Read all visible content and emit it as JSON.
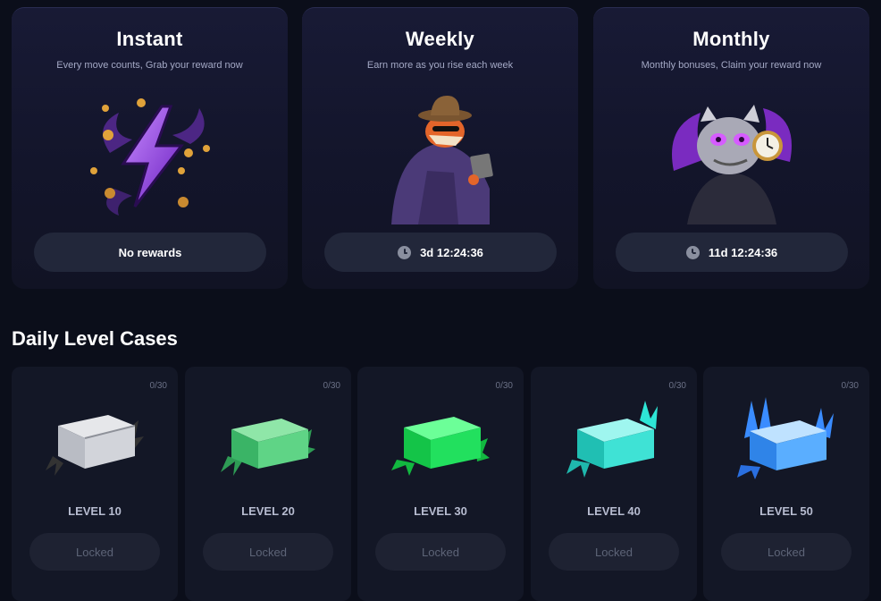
{
  "rewards": [
    {
      "title": "Instant",
      "subtitle": "Every move counts, Grab your reward now",
      "button": "No rewards",
      "has_timer": false
    },
    {
      "title": "Weekly",
      "subtitle": "Earn more as you rise each week",
      "button": "3d 12:24:36",
      "has_timer": true
    },
    {
      "title": "Monthly",
      "subtitle": "Monthly bonuses, Claim your reward now",
      "button": "11d 12:24:36",
      "has_timer": true
    }
  ],
  "daily_cases": {
    "title": "Daily Level Cases",
    "items": [
      {
        "level": "LEVEL 10",
        "progress": "0/30",
        "button": "Locked",
        "color": "#c9ccd4"
      },
      {
        "level": "LEVEL 20",
        "progress": "0/30",
        "button": "Locked",
        "color": "#4fd27a"
      },
      {
        "level": "LEVEL 30",
        "progress": "0/30",
        "button": "Locked",
        "color": "#1fe05a"
      },
      {
        "level": "LEVEL 40",
        "progress": "0/30",
        "button": "Locked",
        "color": "#2ee6d6"
      },
      {
        "level": "LEVEL 50",
        "progress": "0/30",
        "button": "Locked",
        "color": "#3aa8ff"
      }
    ]
  },
  "colors": {
    "background": "#0b0e1a",
    "card": "#13152b",
    "button": "#22273a",
    "accent_purple": "#8b3fe0"
  },
  "icons": [
    "lightning-bolt-icon",
    "fox-detective-icon",
    "dragon-pocket-watch-icon",
    "clock-icon",
    "case-crate-icon"
  ]
}
